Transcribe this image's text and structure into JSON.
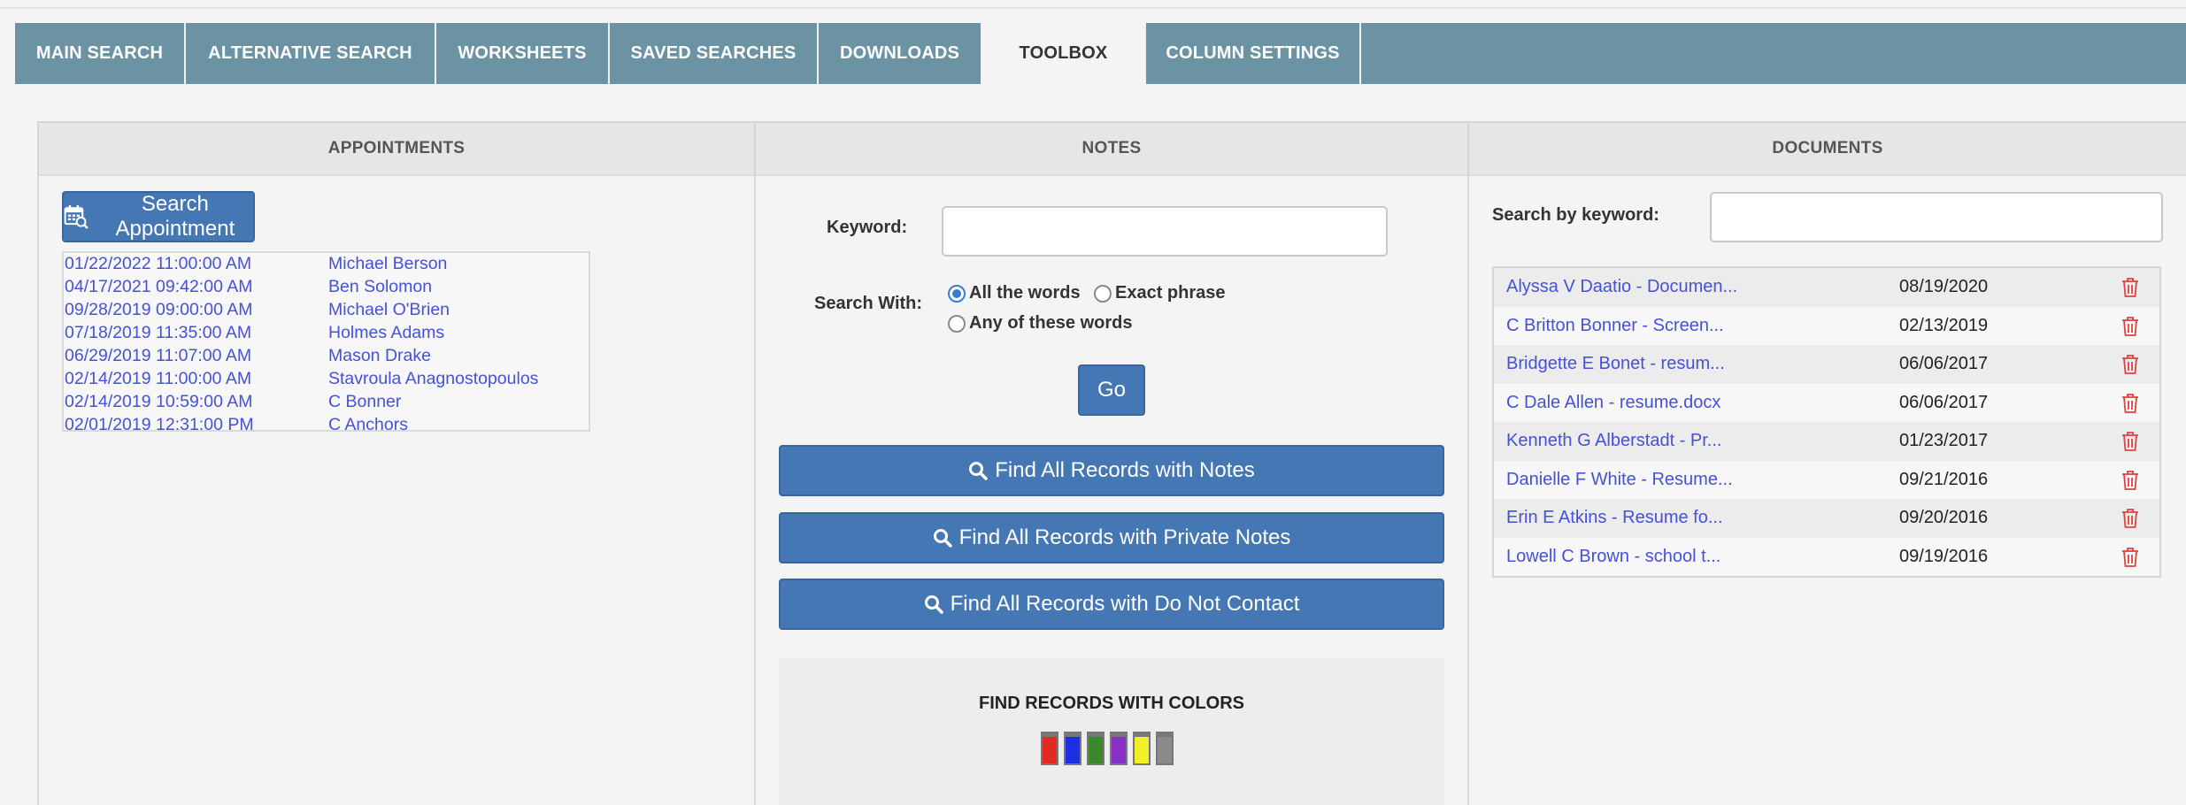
{
  "tabs": [
    {
      "label": "MAIN SEARCH",
      "active": false
    },
    {
      "label": "ALTERNATIVE SEARCH",
      "active": false
    },
    {
      "label": "WORKSHEETS",
      "active": false
    },
    {
      "label": "SAVED SEARCHES",
      "active": false
    },
    {
      "label": "DOWNLOADS",
      "active": false
    },
    {
      "label": "TOOLBOX",
      "active": true
    },
    {
      "label": "COLUMN SETTINGS",
      "active": false
    }
  ],
  "appointments": {
    "title": "APPOINTMENTS",
    "search_button": "Search Appointment",
    "search_icon": "calendar-search-icon",
    "items": [
      {
        "date": "01/22/2022 11:00:00 AM",
        "name": "Michael Berson"
      },
      {
        "date": "04/17/2021 09:42:00 AM",
        "name": "Ben Solomon"
      },
      {
        "date": "09/28/2019 09:00:00 AM",
        "name": "Michael O'Brien"
      },
      {
        "date": "07/18/2019 11:35:00 AM",
        "name": "Holmes Adams"
      },
      {
        "date": "06/29/2019 11:07:00 AM",
        "name": "Mason Drake"
      },
      {
        "date": "02/14/2019 11:00:00 AM",
        "name": "Stavroula Anagnostopoulos"
      },
      {
        "date": "02/14/2019 10:59:00 AM",
        "name": "C Bonner"
      },
      {
        "date": "02/01/2019 12:31:00 PM",
        "name": "C Anchors"
      }
    ]
  },
  "notes": {
    "title": "NOTES",
    "keyword_label": "Keyword:",
    "keyword_value": "",
    "search_with_label": "Search With:",
    "options": [
      "All the words",
      "Exact phrase",
      "Any of these words"
    ],
    "selected_option": "All the words",
    "go_label": "Go",
    "find_notes_label": "Find All Records with Notes",
    "find_private_label": "Find All Records with Private Notes",
    "find_dnc_label": "Find All Records with Do Not Contact",
    "magnifier_icon": "magnifier-icon",
    "colors_title": "FIND RECORDS WITH COLORS",
    "colors": [
      "#e02a22",
      "#1a2fe6",
      "#3a8a2c",
      "#8b2fc9",
      "#f1ee2a",
      "#8a8a8a"
    ]
  },
  "documents": {
    "title": "DOCUMENTS",
    "keyword_label": "Search by keyword:",
    "keyword_value": "",
    "delete_icon": "trash-icon",
    "delete_color": "#e04040",
    "items": [
      {
        "name": "Alyssa V Daatio - Documen...",
        "date": "08/19/2020"
      },
      {
        "name": "C Britton Bonner - Screen...",
        "date": "02/13/2019"
      },
      {
        "name": "Bridgette E Bonet - resum...",
        "date": "06/06/2017"
      },
      {
        "name": "C Dale Allen - resume.docx",
        "date": "06/06/2017"
      },
      {
        "name": "Kenneth G Alberstadt - Pr...",
        "date": "01/23/2017"
      },
      {
        "name": "Danielle F White - Resume...",
        "date": "09/21/2016"
      },
      {
        "name": "Erin E Atkins - Resume fo...",
        "date": "09/20/2016"
      },
      {
        "name": "Lowell C Brown - school t...",
        "date": "09/19/2016"
      }
    ]
  }
}
